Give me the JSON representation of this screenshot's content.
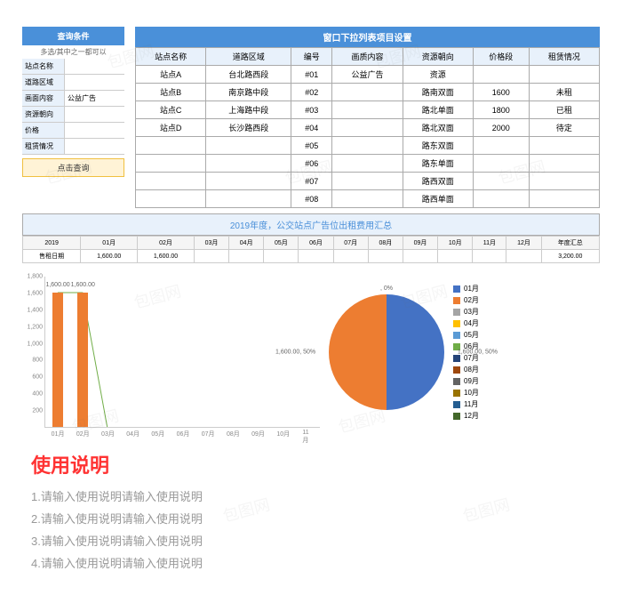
{
  "searchPanel": {
    "header": "查询条件",
    "hint": "多选/其中之一都可以",
    "rows": [
      {
        "label": "站点名称",
        "value": ""
      },
      {
        "label": "道路区域",
        "value": ""
      },
      {
        "label": "画面内容",
        "value": "公益广告"
      },
      {
        "label": "资源朝向",
        "value": ""
      },
      {
        "label": "价格",
        "value": ""
      },
      {
        "label": "租赁情况",
        "value": ""
      }
    ],
    "button": "点击查询"
  },
  "mainTable": {
    "header": "窗口下拉列表项目设置",
    "cols": [
      "站点名称",
      "道路区域",
      "编号",
      "画质内容",
      "资源朝向",
      "价格段",
      "租赁情况"
    ],
    "rows": [
      [
        "站点A",
        "台北路西段",
        "#01",
        "公益广告",
        "资源",
        "",
        ""
      ],
      [
        "站点B",
        "南京路中段",
        "#02",
        "",
        "路南双面",
        "1600",
        "未租"
      ],
      [
        "站点C",
        "上海路中段",
        "#03",
        "",
        "路北单面",
        "1800",
        "已租"
      ],
      [
        "站点D",
        "长沙路西段",
        "#04",
        "",
        "路北双面",
        "2000",
        "待定"
      ],
      [
        "",
        "",
        "#05",
        "",
        "路东双面",
        "",
        ""
      ],
      [
        "",
        "",
        "#06",
        "",
        "路东单面",
        "",
        ""
      ],
      [
        "",
        "",
        "#07",
        "",
        "路西双面",
        "",
        ""
      ],
      [
        "",
        "",
        "#08",
        "",
        "路西单面",
        "",
        ""
      ]
    ]
  },
  "summary": {
    "title": "2019年度，公交站点广告位出租费用汇总",
    "yearLabel": "2019",
    "months": [
      "01月",
      "02月",
      "03月",
      "04月",
      "05月",
      "06月",
      "07月",
      "08月",
      "09月",
      "10月",
      "11月",
      "12月",
      "年度汇总"
    ],
    "rowLabel": "售租日期",
    "values": [
      "1,600.00",
      "1,600.00",
      "",
      "",
      "",
      "",
      "",
      "",
      "",
      "",
      "",
      "",
      "3,200.00"
    ]
  },
  "chart_data": [
    {
      "type": "bar",
      "categories": [
        "01月",
        "02月",
        "03月",
        "04月",
        "05月",
        "06月",
        "07月",
        "08月",
        "09月",
        "10月",
        "11月"
      ],
      "values": [
        1600,
        1600,
        0,
        0,
        0,
        0,
        0,
        0,
        0,
        0,
        0
      ],
      "ylim": [
        0,
        1800
      ],
      "yticks": [
        200,
        400,
        600,
        800,
        1000,
        1200,
        1400,
        1600,
        1800
      ],
      "dataLabels": [
        "1,600.00",
        "1,600.00",
        "",
        "",
        "",
        "",
        "",
        "",
        "",
        "",
        ""
      ]
    },
    {
      "type": "pie",
      "series": [
        {
          "name": "01月",
          "value": 1600,
          "pct": "50%",
          "label": "1,600.00, 50%",
          "color": "#4472c4"
        },
        {
          "name": "02月",
          "value": 1600,
          "pct": "50%",
          "label": "1,600.00, 50%",
          "color": "#ed7d31"
        }
      ],
      "zeroLabel": ", 0%"
    }
  ],
  "legend": {
    "items": [
      {
        "label": "01月",
        "color": "#4472c4"
      },
      {
        "label": "02月",
        "color": "#ed7d31"
      },
      {
        "label": "03月",
        "color": "#a5a5a5"
      },
      {
        "label": "04月",
        "color": "#ffc000"
      },
      {
        "label": "05月",
        "color": "#5b9bd5"
      },
      {
        "label": "06月",
        "color": "#70ad47"
      },
      {
        "label": "07月",
        "color": "#264478"
      },
      {
        "label": "08月",
        "color": "#9e480e"
      },
      {
        "label": "09月",
        "color": "#636363"
      },
      {
        "label": "10月",
        "color": "#997300"
      },
      {
        "label": "11月",
        "color": "#255e91"
      },
      {
        "label": "12月",
        "color": "#43682b"
      }
    ]
  },
  "instructions": {
    "header": "使用说明",
    "lines": [
      "1.请输入使用说明请输入使用说明",
      "2.请输入使用说明请输入使用说明",
      "3.请输入使用说明请输入使用说明",
      "4.请输入使用说明请输入使用说明"
    ]
  },
  "watermark": "包图网"
}
